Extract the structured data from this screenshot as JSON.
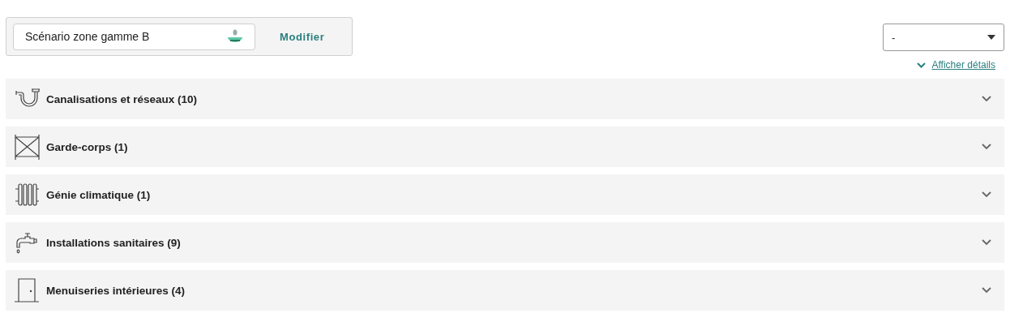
{
  "scenario": {
    "value": "Scénario zone gamme B",
    "action": "Modifier"
  },
  "select": {
    "value": "-"
  },
  "details_link": {
    "label": "Afficher détails"
  },
  "sections": [
    {
      "kind": "pipe",
      "label": "Canalisations et réseaux (10)",
      "expanded": false
    },
    {
      "kind": "railing",
      "label": "Garde-corps (1)",
      "expanded": false
    },
    {
      "kind": "radiator",
      "label": "Génie climatique (1)",
      "expanded": false
    },
    {
      "kind": "faucet",
      "label": "Installations sanitaires (9)",
      "expanded": false
    },
    {
      "kind": "door",
      "label": "Menuiseries intérieures (4)",
      "expanded": false
    }
  ]
}
